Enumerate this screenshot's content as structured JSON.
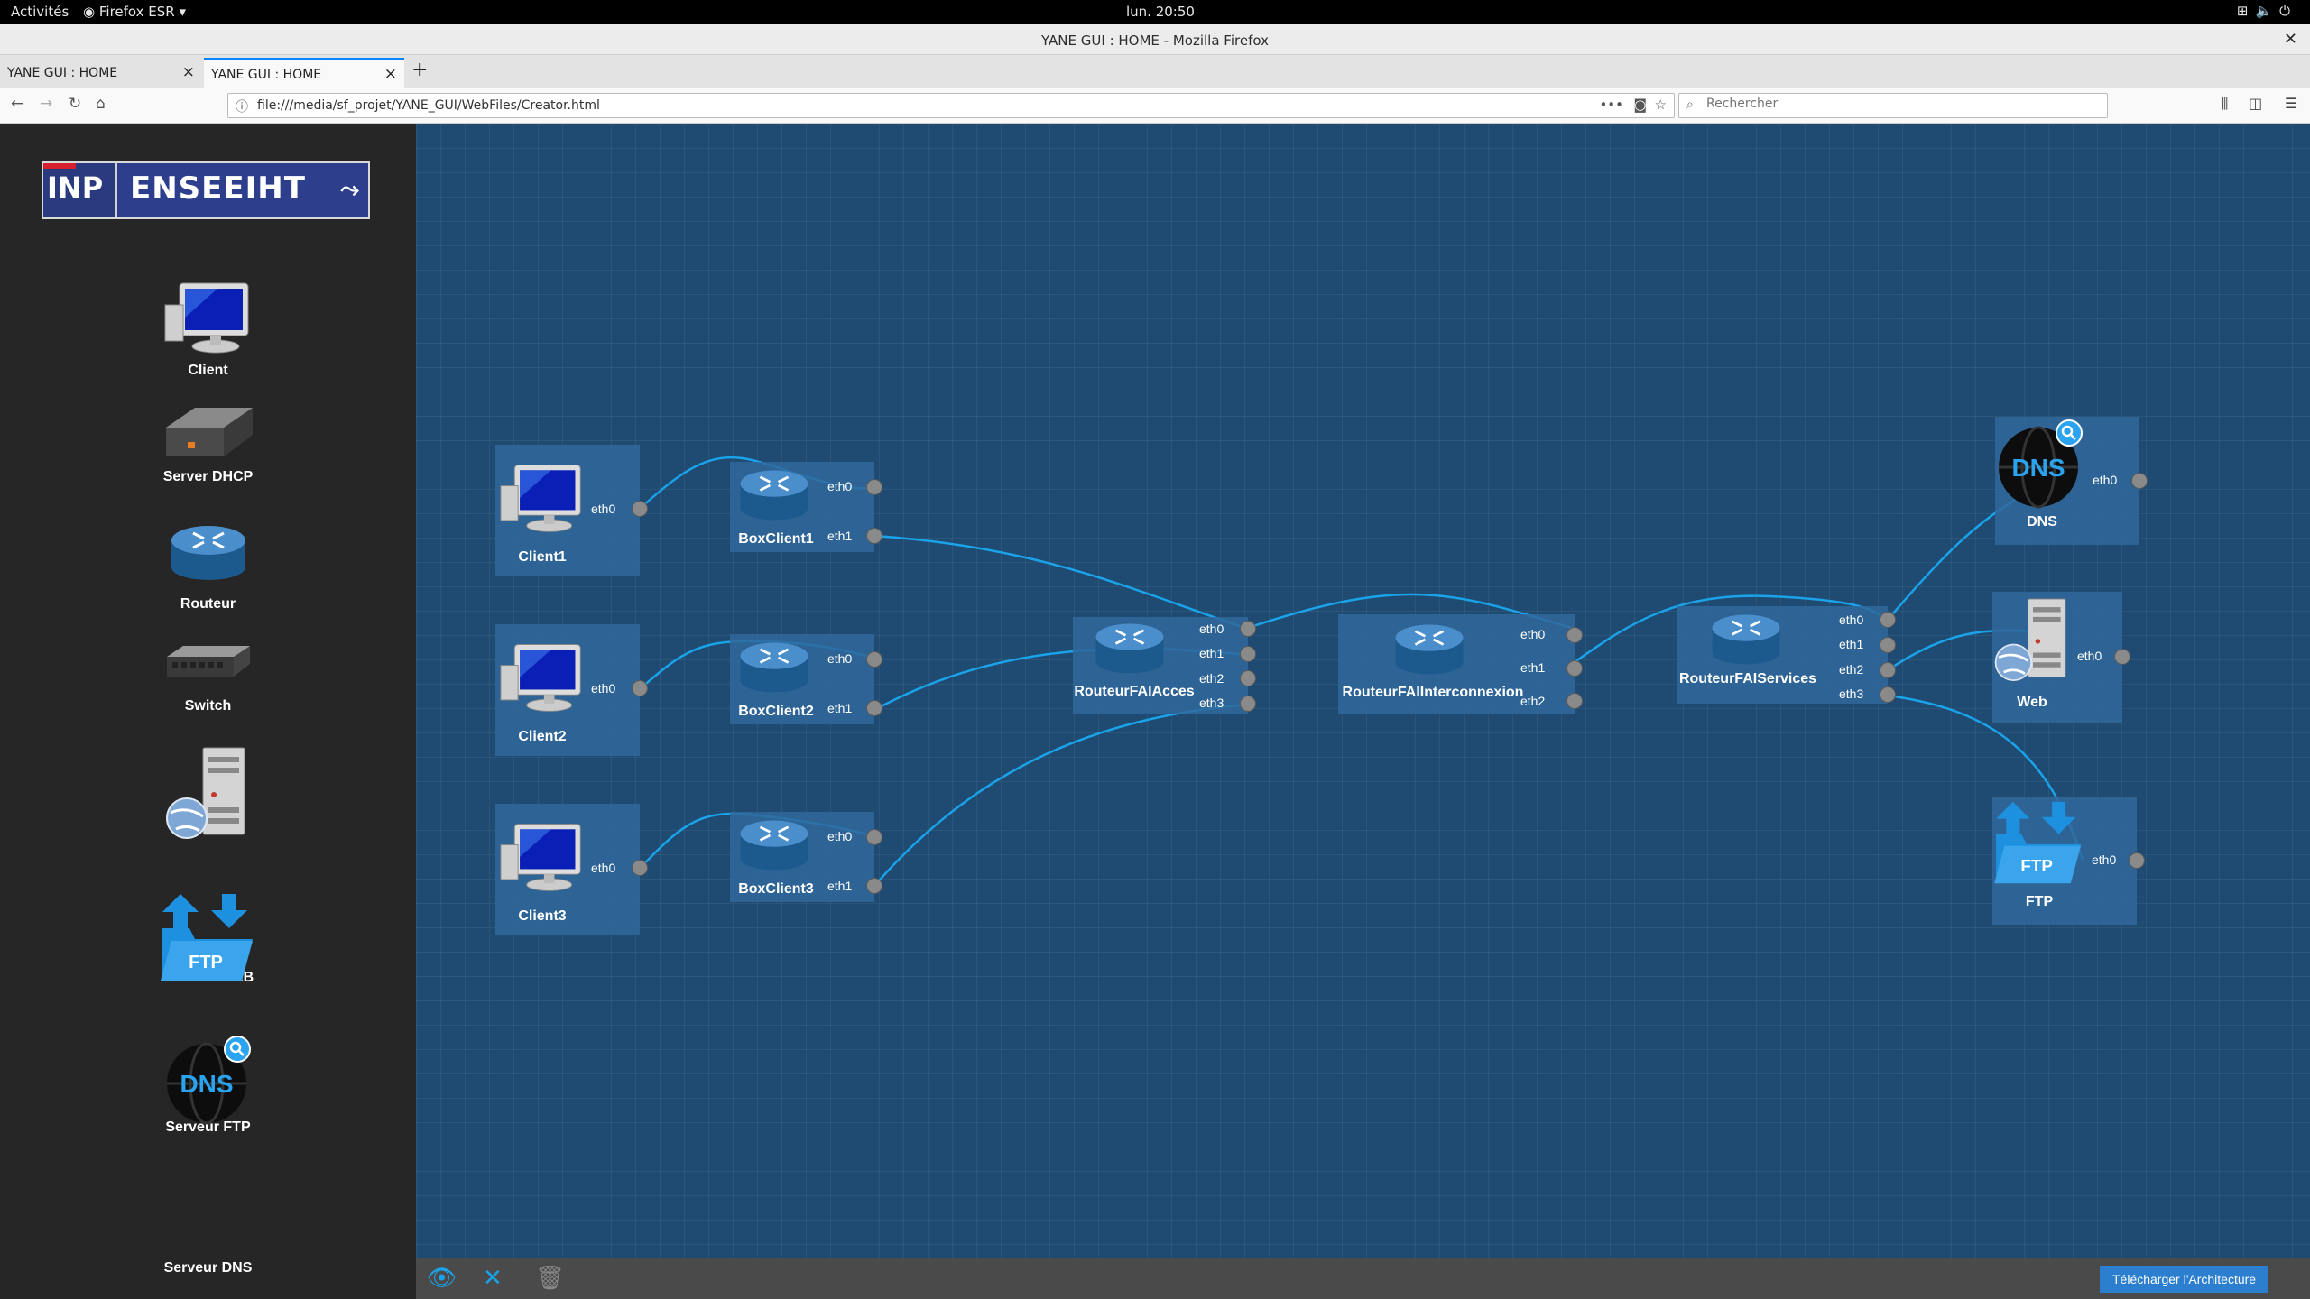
{
  "system": {
    "activities": "Activités",
    "firefox_menu": "Firefox ESR ▾",
    "clock": "lun. 20:50",
    "tray_icons": [
      "network-icon",
      "volume-icon",
      "power-icon"
    ]
  },
  "window": {
    "title": "YANE GUI : HOME - Mozilla Firefox",
    "close": "✕"
  },
  "tabs": [
    {
      "label": "YANE GUI : HOME",
      "active": false
    },
    {
      "label": "YANE GUI : HOME",
      "active": true
    }
  ],
  "nav": {
    "url": "file:///media/sf_projet/YANE_GUI/WebFiles/Creator.html",
    "search_placeholder": "Rechercher",
    "more": "•••"
  },
  "palette": [
    {
      "id": "client",
      "label": "Client",
      "icon": "computer-icon"
    },
    {
      "id": "dhcp",
      "label": "Server DHCP",
      "icon": "dhcp-server-icon"
    },
    {
      "id": "router",
      "label": "Routeur",
      "icon": "router-icon"
    },
    {
      "id": "switch",
      "label": "Switch",
      "icon": "switch-icon"
    },
    {
      "id": "web",
      "label": "Serveur WEB",
      "icon": "web-server-icon"
    },
    {
      "id": "ftp",
      "label": "Serveur FTP",
      "icon": "ftp-icon"
    },
    {
      "id": "dns",
      "label": "Serveur DNS",
      "icon": "dns-icon"
    }
  ],
  "logo": {
    "left": "INP",
    "right": "ENSEEIHT"
  },
  "nodes": {
    "client1": {
      "label": "Client1",
      "ports": [
        "eth0"
      ]
    },
    "client2": {
      "label": "Client2",
      "ports": [
        "eth0"
      ]
    },
    "client3": {
      "label": "Client3",
      "ports": [
        "eth0"
      ]
    },
    "box1": {
      "label": "BoxClient1",
      "ports": [
        "eth0",
        "eth1"
      ]
    },
    "box2": {
      "label": "BoxClient2",
      "ports": [
        "eth0",
        "eth1"
      ]
    },
    "box3": {
      "label": "BoxClient3",
      "ports": [
        "eth0",
        "eth1"
      ]
    },
    "acces": {
      "label": "RouteurFAIAcces",
      "ports": [
        "eth0",
        "eth1",
        "eth2",
        "eth3"
      ]
    },
    "inter": {
      "label": "RouteurFAIInterconnexion",
      "ports": [
        "eth0",
        "eth1",
        "eth2"
      ]
    },
    "services": {
      "label": "RouteurFAIServices",
      "ports": [
        "eth0",
        "eth1",
        "eth2",
        "eth3"
      ]
    },
    "dns": {
      "label": "DNS",
      "ports": [
        "eth0"
      ]
    },
    "web": {
      "label": "Web",
      "ports": [
        "eth0"
      ]
    },
    "ftp": {
      "label": "FTP",
      "ports": [
        "eth0"
      ]
    }
  },
  "icon_text": {
    "dns": "DNS",
    "ftp": "FTP"
  },
  "toolbar": {
    "view_icon": "eye-icon",
    "clear_icon": "cross-icon",
    "delete_icon": "trash-icon",
    "download_label": "Télécharger l'Architecture"
  },
  "colors": {
    "link": "#1aa3e8",
    "canvas": "#1f4a72",
    "accent": "#2c7fcf"
  }
}
